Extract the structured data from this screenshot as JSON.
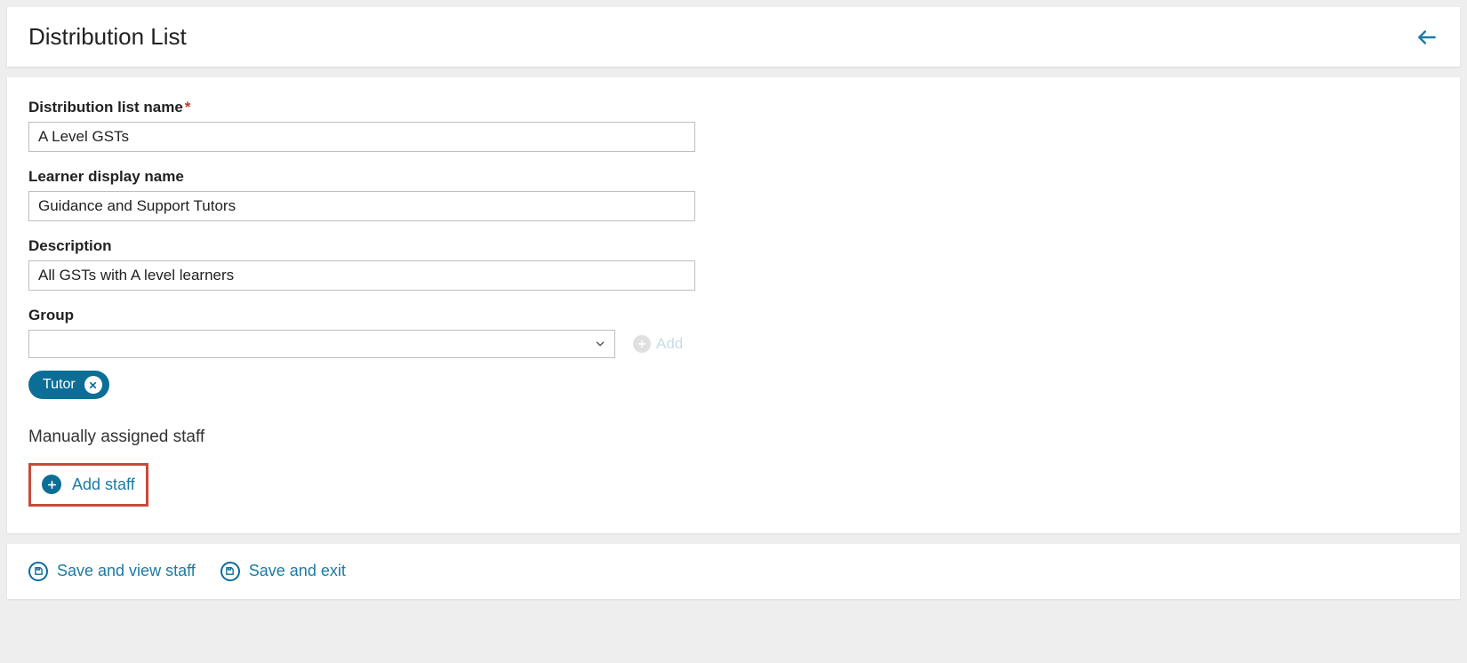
{
  "header": {
    "title": "Distribution List"
  },
  "form": {
    "name_label": "Distribution list name",
    "name_value": "A Level GSTs",
    "learner_label": "Learner display name",
    "learner_value": "Guidance and Support Tutors",
    "desc_label": "Description",
    "desc_value": "All GSTs with A level learners",
    "group_label": "Group",
    "group_value": "",
    "group_add_label": "Add",
    "chips": [
      {
        "label": "Tutor"
      }
    ],
    "manual_heading": "Manually assigned staff",
    "add_staff_label": "Add staff"
  },
  "footer": {
    "save_view_label": "Save and view staff",
    "save_exit_label": "Save and exit"
  }
}
